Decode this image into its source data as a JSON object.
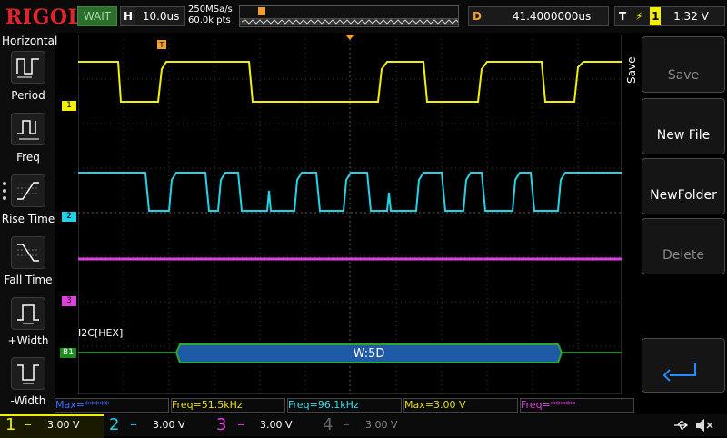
{
  "header": {
    "brand": "RIGOL",
    "status": "WAIT",
    "timebase_key": "H",
    "timebase": "10.0us",
    "sample_rate": "250MSa/s",
    "memory_depth": "60.0k pts",
    "delay_key": "D",
    "delay": "41.4000000us",
    "trigger_key": "T",
    "trigger_source": "1",
    "trigger_level": "1.32 V"
  },
  "left_panel": {
    "title": "Horizontal",
    "items": [
      {
        "label": "Period",
        "icon": "period-icon"
      },
      {
        "label": "Freq",
        "icon": "freq-icon"
      },
      {
        "label": "Rise Time",
        "icon": "rise-time-icon"
      },
      {
        "label": "Fall Time",
        "icon": "fall-time-icon"
      },
      {
        "label": "+Width",
        "icon": "positive-width-icon"
      },
      {
        "label": "-Width",
        "icon": "negative-width-icon"
      }
    ]
  },
  "channels": {
    "ch1_marker": "1",
    "ch2_marker": "2",
    "ch3_marker": "3",
    "bus_marker": "B1",
    "bus_label": "I2C[HEX]",
    "bus_packet": "W:5D",
    "trigger_marker": "T"
  },
  "right_panel": {
    "header": "Save",
    "buttons": [
      "Save",
      "New File",
      "NewFolder",
      "Delete"
    ],
    "return_icon": "return-arrow-icon"
  },
  "measurements": [
    {
      "text": "Max=*****",
      "color": "#3a6cff"
    },
    {
      "text": "Freq=51.5kHz",
      "color": "#e8e000"
    },
    {
      "text": "Freq=96.1kHz",
      "color": "#33e0f0"
    },
    {
      "text": "Max=3.00 V",
      "color": "#e8e000"
    },
    {
      "text": "Freq=*****",
      "color": "#e040e0"
    }
  ],
  "bottom": {
    "ch1": {
      "num": "1",
      "value": "3.00 V",
      "color": "#f0f000"
    },
    "ch2": {
      "num": "2",
      "value": "3.00 V",
      "color": "#22d3e6"
    },
    "ch3": {
      "num": "3",
      "value": "3.00 V",
      "color": "#e040e0"
    },
    "ch4": {
      "num": "4",
      "value": "3.00 V",
      "color": "#555555"
    },
    "usb_icon": "usb-icon",
    "speaker_icon": "speaker-muted-icon"
  },
  "colors": {
    "ch1": "#f0f000",
    "ch2": "#22d3e6",
    "ch3": "#e040e0",
    "bus": "#1f8a1f",
    "bus_packet_fill": "#1f5aa6",
    "trigger": "#f0a030",
    "grid": "#3a3a3a"
  }
}
